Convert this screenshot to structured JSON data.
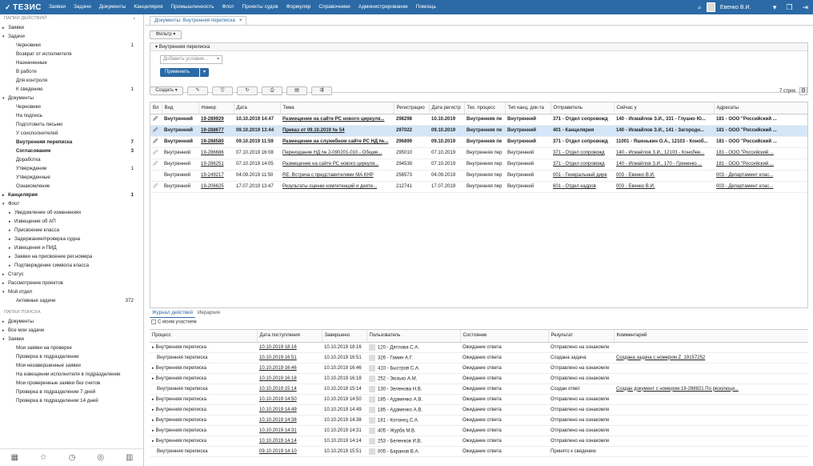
{
  "app": {
    "logo": "ТЕЗИС",
    "user": "Евенко В.И."
  },
  "menu": [
    "Заявки",
    "Задачи",
    "Документы",
    "Канцелярия",
    "Промышленность",
    "Флот",
    "Проекты судов",
    "Формуляр",
    "Справочники",
    "Администрирование",
    "Помощь"
  ],
  "sidebar": {
    "sec1": "ПАПКИ ДЕЙСТВИЙ",
    "sec2": "ПАПКИ ПОИСКА",
    "items": [
      {
        "t": "Заявки",
        "arr": "▸",
        "c": ""
      },
      {
        "t": "Задачи",
        "arr": "▾",
        "c": ""
      },
      {
        "t": "Черновики",
        "c": "1"
      },
      {
        "t": "Возврат от исполнителя",
        "c": ""
      },
      {
        "t": "Назначенные",
        "c": ""
      },
      {
        "t": "В работе",
        "c": ""
      },
      {
        "t": "Для контроля",
        "c": ""
      },
      {
        "t": "К сведению",
        "c": "1"
      },
      {
        "t": "Документы",
        "arr": "▾",
        "c": ""
      },
      {
        "t": "Черновики",
        "c": ""
      },
      {
        "t": "На подпись",
        "c": ""
      },
      {
        "t": "Подготовить письмо",
        "c": ""
      },
      {
        "t": "У соисполнителей",
        "c": ""
      },
      {
        "t": "Внутренняя переписка",
        "c": "7"
      },
      {
        "t": "Согласование",
        "c": "3"
      },
      {
        "t": "Доработка",
        "c": ""
      },
      {
        "t": "Утверждение",
        "c": "1"
      },
      {
        "t": "Утвержденные",
        "c": ""
      },
      {
        "t": "Ознакомление",
        "c": ""
      },
      {
        "t": "Канцелярия",
        "arr": "▸",
        "c": "1"
      },
      {
        "t": "Флот",
        "arr": "▾",
        "c": ""
      },
      {
        "t": "Уведомление об изменениях",
        "arr": "▸"
      },
      {
        "t": "Извещение об АП",
        "arr": "▸"
      },
      {
        "t": "Присвоение класса",
        "arr": "▸"
      },
      {
        "t": "Задержание/проверка судна",
        "arr": "▸"
      },
      {
        "t": "Извещения и ПИД",
        "arr": "▸"
      },
      {
        "t": "Заявки на присвоение рег.номера",
        "arr": "▸"
      },
      {
        "t": "Подтверждение символа класса",
        "arr": "▸"
      },
      {
        "t": "Статус",
        "arr": "▸"
      },
      {
        "t": "Рассмотрение проектов",
        "arr": "▸"
      },
      {
        "t": "Мой отдел",
        "arr": "▾"
      },
      {
        "t": "Активные задачи",
        "c": "372"
      }
    ],
    "search": [
      {
        "t": "Документы",
        "arr": "▸"
      },
      {
        "t": "Все мои задачи",
        "arr": "▸"
      },
      {
        "t": "Заявки",
        "arr": "▾"
      },
      {
        "t": "Мои заявки на проверке"
      },
      {
        "t": "Проверка в подразделении"
      },
      {
        "t": "Мои незавершенные заявки"
      },
      {
        "t": "На извещении исполнителя в подразделении"
      },
      {
        "t": "Мои проверенные заявки без счетов"
      },
      {
        "t": "Проверка в подразделении 7 дней"
      },
      {
        "t": "Проверка в подразделении 14 дней"
      }
    ]
  },
  "tab": {
    "label": "Документы: Внутренняя переписка"
  },
  "toolbar": {
    "filter": "Фильтр",
    "create": "Создать",
    "count": "7 строк"
  },
  "filter": {
    "title": "Внутренняя переписка",
    "placeholder": "Добавить условие...",
    "apply": "Применить"
  },
  "grid": {
    "headers": [
      "Вл",
      "Вид",
      "Номер",
      "Дата",
      "Тема",
      "Регистрацио",
      "Дата регистр",
      "Тех. процесс",
      "Тип канц. док-та",
      "Отправитель",
      "Сейчас у",
      "Адресаты"
    ],
    "rows": [
      {
        "vid": "Внутренний",
        "num": "19-289929",
        "date": "10.10.2019 14:47",
        "theme": "Размещение на сайте РС нового циркуля...",
        "reg": "298298",
        "regdate": "10.10.2019",
        "proc": "Внутренняя пе",
        "type": "Внутренний",
        "from": "371 - Отдел сопровожд",
        "now": "140 - Исмайлов З.И., 331 - Глушко Ю...",
        "to": "181 - ООО \"Российский ..."
      },
      {
        "vid": "Внутренний",
        "num": "19-288677",
        "date": "09.10.2019 13:44",
        "theme": "Приказ от 09.10.2019 № 54",
        "reg": "297022",
        "regdate": "09.10.2019",
        "proc": "Внутренняя пе",
        "type": "Внутренний",
        "from": "401 - Канцелярия",
        "now": "140 - Исмайлов З.И., 141 - Загородн...",
        "to": "181 - ООО \"Российский ..."
      },
      {
        "vid": "Внутренний",
        "num": "19-288580",
        "date": "09.10.2019 11:59",
        "theme": "Размещение на служебном сайте РС НД №...",
        "reg": "296899",
        "regdate": "09.10.2019",
        "proc": "Внутренняя пе",
        "type": "Внутренний",
        "from": "371 - Отдел сопровожд",
        "now": "11001 - Яшенькин О.А., 12103 - Коноб...",
        "to": "181 - ООО \"Российский ..."
      },
      {
        "vid": "Внутренний",
        "num": "19-286686",
        "date": "07.10.2019 16:08",
        "theme": "Переиздание НД № 2-090201-010 - Общие...",
        "reg": "295010",
        "regdate": "07.10.2019",
        "proc": "Внутренняя пер",
        "type": "Внутренний",
        "from": "371 - Отдел сопровожд",
        "now": "140 - Исмайлов З.И., 12103 - Конобее...",
        "to": "181 - ООО \"Российский ..."
      },
      {
        "vid": "Внутренний",
        "num": "19-286251",
        "date": "07.10.2019 14:05",
        "theme": "Размещение на сайте РС нового циркуля...",
        "reg": "294539",
        "regdate": "07.10.2019",
        "proc": "Внутренняя пер",
        "type": "Внутренний",
        "from": "371 - Отдел сопровожд",
        "now": "140 - Исмайлов З.И., 170 - Гриненко ...",
        "to": "181 - ООО \"Российский ..."
      },
      {
        "vid": "Внутренний",
        "num": "19-249217",
        "date": "04.09.2019 11:50",
        "theme": "RE: Встреча с представителями МА КНР",
        "reg": "256573",
        "regdate": "04.09.2019",
        "proc": "Внутренняя пер",
        "type": "Внутренний",
        "from": "001 - Генеральный дире",
        "now": "003 - Евенко В.И.",
        "to": "003 - Департамент клас..."
      },
      {
        "vid": "Внутренний",
        "num": "19-206625",
        "date": "17.07.2019 13:47",
        "theme": "Результаты оценки компетенций и деяте...",
        "reg": "212741",
        "regdate": "17.07.2019",
        "proc": "Внутренняя пер",
        "type": "Внутренний",
        "from": "601 - Отдел кадров",
        "now": "003 - Евенко В.И.",
        "to": "003 - Департамент клас..."
      }
    ]
  },
  "bottom": {
    "tab1": "Журнал действий",
    "tab2": "Иерархия",
    "check": "С моим участием",
    "headers": [
      "Процесс",
      "Дата поступления",
      "Завершено",
      "Пользователь",
      "Состояние",
      "Результат",
      "Комментарий"
    ],
    "rows": [
      {
        "p": "Внутренняя переписка",
        "d": "10.10.2019 18:16",
        "e": "10.10.2019 18:16",
        "u": "120 - Дятлова С.А.",
        "s": "Ожидание ответа",
        "r": "Отправлено на ознакомле",
        "c": ""
      },
      {
        "p": "Внутренняя переписка",
        "d": "10.10.2019 16:51",
        "e": "10.10.2019 16:51",
        "u": "326 - Гамин А.Г.",
        "s": "Ожидание ответа",
        "r": "Создана задача",
        "c": "Создана задача с номером Z_19157252"
      },
      {
        "p": "Внутренняя переписка",
        "d": "10.10.2019 16:46",
        "e": "10.10.2019 16:46",
        "u": "410 - Быстров С.А.",
        "s": "Ожидание ответа",
        "r": "Отправлено на ознакомле",
        "c": ""
      },
      {
        "p": "Внутренняя переписка",
        "d": "10.10.2019 16:18",
        "e": "10.10.2019 16:18",
        "u": "252 - Зюзько А.М.",
        "s": "Ожидание ответа",
        "r": "Отправлено на ознакомле",
        "c": ""
      },
      {
        "p": "Внутренняя переписка",
        "d": "10.10.2019 15:14",
        "e": "10.10.2019 15:14",
        "u": "130 - Зеленова Н.В.",
        "s": "Ожидание ответа",
        "r": "Создан ответ",
        "c": "Создан документ с номером 19-288821 По резолюци..."
      },
      {
        "p": "Внутренняя переписка",
        "d": "10.10.2019 14:50",
        "e": "10.10.2019 14:50",
        "u": "185 - Адаменко А.В.",
        "s": "Ожидание ответа",
        "r": "Отправлено на ознакомле",
        "c": ""
      },
      {
        "p": "Внутренняя переписка",
        "d": "10.10.2019 14:49",
        "e": "10.10.2019 14:49",
        "u": "185 - Адаменко А.В.",
        "s": "Ожидание ответа",
        "r": "Отправлено на ознакомле",
        "c": ""
      },
      {
        "p": "Внутренняя переписка",
        "d": "10.10.2019 14:38",
        "e": "10.10.2019 14:38",
        "u": "181 - Котонец С.А.",
        "s": "Ожидание ответа",
        "r": "Отправлено на ознакомле",
        "c": ""
      },
      {
        "p": "Внутренняя переписка",
        "d": "10.10.2019 14:31",
        "e": "10.10.2019 14:31",
        "u": "405 - Журба М.В.",
        "s": "Ожидание ответа",
        "r": "Отправлено на ознакомле",
        "c": ""
      },
      {
        "p": "Внутренняя переписка",
        "d": "10.10.2019 14:14",
        "e": "10.10.2019 14:14",
        "u": "253 - Беленков И.В.",
        "s": "Ожидание ответа",
        "r": "Отправлено на ознакомле",
        "c": ""
      },
      {
        "p": "Внутренняя переписка",
        "d": "09.10.2019 14:10",
        "e": "10.10.2019 15:51",
        "u": "005 - Баранов В.А.",
        "s": "Ожидание ответа",
        "r": "Принято к сведению",
        "c": ""
      }
    ]
  }
}
